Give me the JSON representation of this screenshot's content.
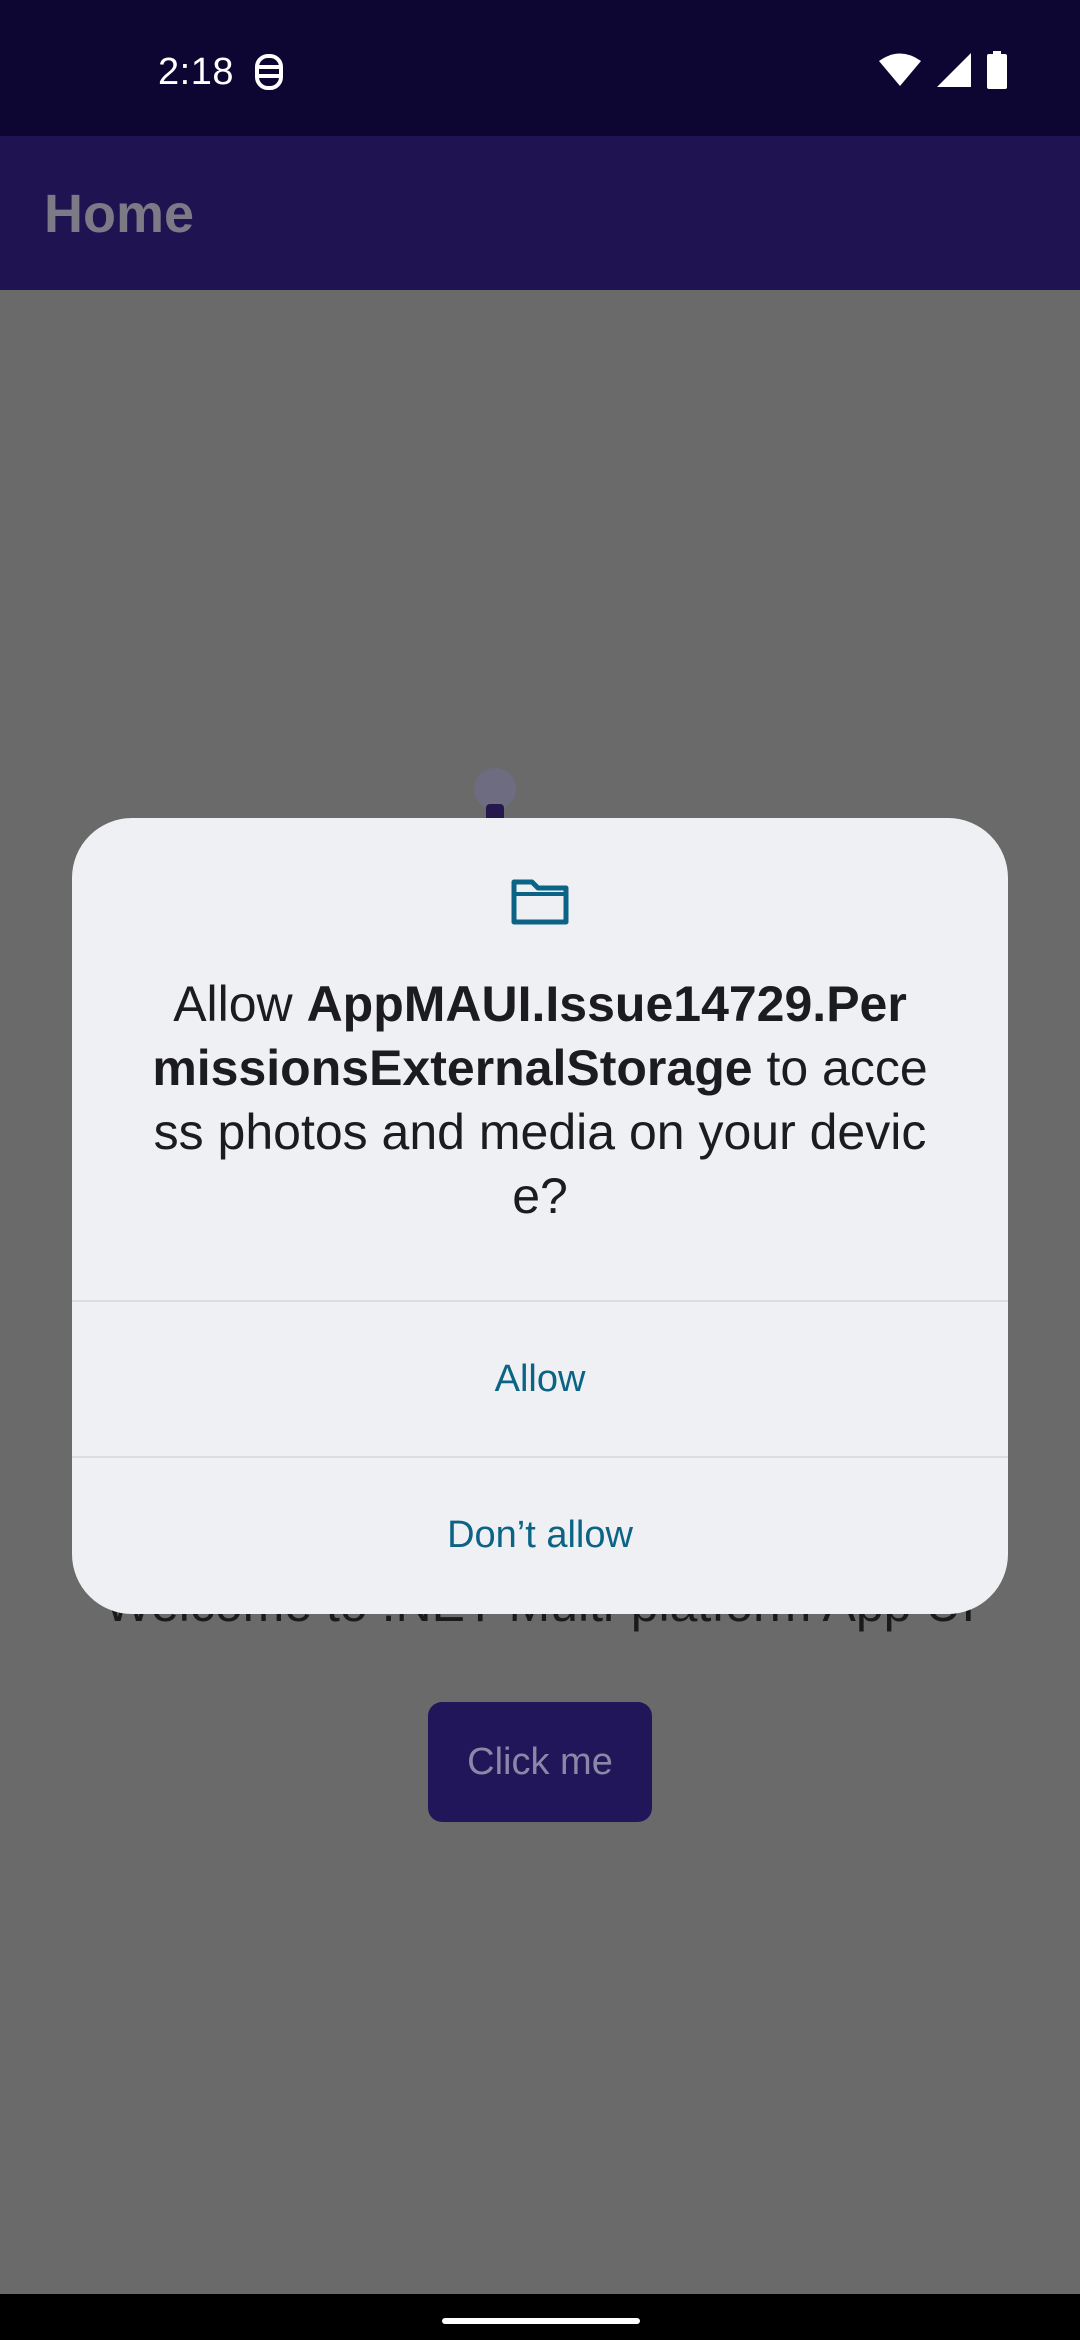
{
  "status_bar": {
    "time": "2:18",
    "left_icon": "accessibility-icon",
    "right_icons": [
      "wifi-icon",
      "cellular-signal-icon",
      "battery-icon"
    ]
  },
  "app_bar": {
    "title": "Home"
  },
  "content": {
    "welcome_text": "Welcome to .NET Multi-platform App UI",
    "button_label": "Click me"
  },
  "dialog": {
    "icon": "folder-icon",
    "message_prefix": "Allow ",
    "app_name": "AppMAUI.Issue14729.PermissionsExternalStorage",
    "message_suffix": " to access photos and media on your device?",
    "allow_label": "Allow",
    "deny_label": "Don’t allow"
  },
  "colors": {
    "status_bar": "#0e0632",
    "app_bar": "#1f1352",
    "scrim_background": "#6a6a6a",
    "dialog_background": "#eff0f3",
    "accent": "#0b6385",
    "primary_button": "#21165a"
  }
}
